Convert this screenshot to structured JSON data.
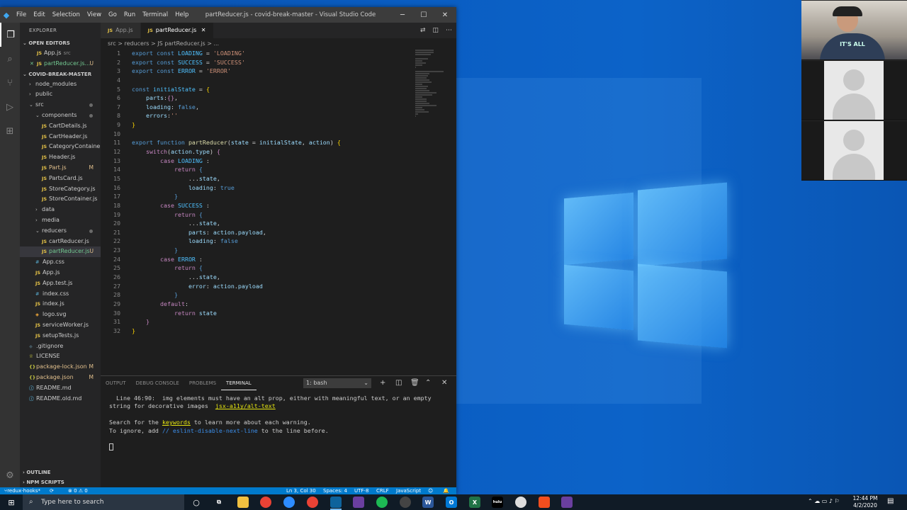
{
  "colors": {
    "accent": "#007acc",
    "desktop": "#0a5dc2",
    "editor_bg": "#1e1e1e"
  },
  "window": {
    "title": "partReducer.js - covid-break-master - Visual Studio Code",
    "menu": [
      "File",
      "Edit",
      "Selection",
      "View",
      "Go",
      "Run",
      "Terminal",
      "Help"
    ]
  },
  "sidebar": {
    "header": "EXPLORER",
    "open_editors_label": "OPEN EDITORS",
    "open_editors": [
      {
        "icon": "JS",
        "name": "App.js",
        "sub": "src"
      },
      {
        "icon": "JS",
        "name": "partReducer.js...",
        "badge": "U"
      }
    ],
    "project_label": "COVID-BREAK-MASTER",
    "tree": [
      {
        "indent": 1,
        "type": "folder",
        "name": "node_modules"
      },
      {
        "indent": 1,
        "type": "folder",
        "name": "public"
      },
      {
        "indent": 1,
        "type": "folder-open",
        "name": "src",
        "dot": true
      },
      {
        "indent": 2,
        "type": "folder-open",
        "name": "components",
        "dot": true
      },
      {
        "indent": 3,
        "icon": "JS",
        "name": "CartDetails.js"
      },
      {
        "indent": 3,
        "icon": "JS",
        "name": "CartHeader.js"
      },
      {
        "indent": 3,
        "icon": "JS",
        "name": "CategoryContainer.js"
      },
      {
        "indent": 3,
        "icon": "JS",
        "name": "Header.js"
      },
      {
        "indent": 3,
        "icon": "JS",
        "name": "Part.js",
        "badge": "M",
        "state": "mod"
      },
      {
        "indent": 3,
        "icon": "JS",
        "name": "PartsCard.js"
      },
      {
        "indent": 3,
        "icon": "JS",
        "name": "StoreCategory.js"
      },
      {
        "indent": 3,
        "icon": "JS",
        "name": "StoreContainer.js"
      },
      {
        "indent": 2,
        "type": "folder",
        "name": "data"
      },
      {
        "indent": 2,
        "type": "folder",
        "name": "media"
      },
      {
        "indent": 2,
        "type": "folder-open",
        "name": "reducers",
        "dot": true
      },
      {
        "indent": 3,
        "icon": "JS",
        "name": "cartReducer.js"
      },
      {
        "indent": 3,
        "icon": "JS",
        "name": "partReducer.js",
        "badge": "U",
        "state": "untr",
        "selected": true
      },
      {
        "indent": 2,
        "icon": "#",
        "name": "App.css"
      },
      {
        "indent": 2,
        "icon": "JS",
        "name": "App.js"
      },
      {
        "indent": 2,
        "icon": "JS",
        "name": "App.test.js"
      },
      {
        "indent": 2,
        "icon": "#",
        "name": "index.css"
      },
      {
        "indent": 2,
        "icon": "JS",
        "name": "index.js"
      },
      {
        "indent": 2,
        "icon": "◈",
        "name": "logo.svg"
      },
      {
        "indent": 2,
        "icon": "JS",
        "name": "serviceWorker.js"
      },
      {
        "indent": 2,
        "icon": "JS",
        "name": "setupTests.js"
      },
      {
        "indent": 1,
        "icon": "◆",
        "name": ".gitignore"
      },
      {
        "indent": 1,
        "icon": "♕",
        "name": "LICENSE"
      },
      {
        "indent": 1,
        "icon": "{}",
        "name": "package-lock.json",
        "badge": "M",
        "state": "mod"
      },
      {
        "indent": 1,
        "icon": "{}",
        "name": "package.json",
        "badge": "M",
        "state": "mod"
      },
      {
        "indent": 1,
        "icon": "ⓘ",
        "name": "README.md"
      },
      {
        "indent": 1,
        "icon": "ⓘ",
        "name": "README.old.md"
      }
    ],
    "outline_label": "OUTLINE",
    "npm_label": "NPM SCRIPTS"
  },
  "tabs": [
    {
      "icon": "JS",
      "label": "App.js",
      "active": false
    },
    {
      "icon": "JS",
      "label": "partReducer.js",
      "active": true
    }
  ],
  "breadcrumb": "src > reducers > JS partReducer.js > ...",
  "code_lines": [
    [
      [
        "k",
        "export "
      ],
      [
        "k",
        "const "
      ],
      [
        "c",
        "LOADING"
      ],
      [
        "p",
        " = "
      ],
      [
        "s",
        "'LOADING'"
      ]
    ],
    [
      [
        "k",
        "export "
      ],
      [
        "k",
        "const "
      ],
      [
        "c",
        "SUCCESS"
      ],
      [
        "p",
        " = "
      ],
      [
        "s",
        "'SUCCESS'"
      ]
    ],
    [
      [
        "k",
        "export "
      ],
      [
        "k",
        "const "
      ],
      [
        "c",
        "ERROR"
      ],
      [
        "p",
        " = "
      ],
      [
        "s",
        "'ERROR'"
      ]
    ],
    [],
    [
      [
        "k",
        "const "
      ],
      [
        "c",
        "initialState"
      ],
      [
        "p",
        " = "
      ],
      [
        "b",
        "{"
      ]
    ],
    [
      [
        "p",
        "    "
      ],
      [
        "v",
        "parts"
      ],
      [
        "p",
        ":"
      ],
      [
        "kc",
        "{}"
      ],
      [
        "p",
        ","
      ]
    ],
    [
      [
        "p",
        "    "
      ],
      [
        "v",
        "loading"
      ],
      [
        "p",
        ": "
      ],
      [
        "k",
        "false"
      ],
      [
        "p",
        ","
      ]
    ],
    [
      [
        "p",
        "    "
      ],
      [
        "v",
        "errors"
      ],
      [
        "p",
        ":"
      ],
      [
        "s",
        "''"
      ]
    ],
    [
      [
        "b",
        "}"
      ]
    ],
    [],
    [
      [
        "k",
        "export "
      ],
      [
        "k",
        "function "
      ],
      [
        "f",
        "partReducer"
      ],
      [
        "p",
        "("
      ],
      [
        "v",
        "state"
      ],
      [
        "p",
        " = "
      ],
      [
        "v",
        "initialState"
      ],
      [
        "p",
        ", "
      ],
      [
        "v",
        "action"
      ],
      [
        "p",
        ") "
      ],
      [
        "b",
        "{"
      ]
    ],
    [
      [
        "p",
        "    "
      ],
      [
        "kc",
        "switch"
      ],
      [
        "p",
        "("
      ],
      [
        "v",
        "action"
      ],
      [
        "p",
        "."
      ],
      [
        "v",
        "type"
      ],
      [
        "p",
        ") "
      ],
      [
        "kc",
        "{"
      ]
    ],
    [
      [
        "p",
        "        "
      ],
      [
        "kc",
        "case "
      ],
      [
        "c",
        "LOADING"
      ],
      [
        "p",
        " :"
      ]
    ],
    [
      [
        "p",
        "            "
      ],
      [
        "kc",
        "return "
      ],
      [
        "k",
        "{"
      ]
    ],
    [
      [
        "p",
        "                ..."
      ],
      [
        "v",
        "state"
      ],
      [
        "p",
        ","
      ]
    ],
    [
      [
        "p",
        "                "
      ],
      [
        "v",
        "loading"
      ],
      [
        "p",
        ": "
      ],
      [
        "k",
        "true"
      ]
    ],
    [
      [
        "p",
        "            "
      ],
      [
        "k",
        "}"
      ]
    ],
    [
      [
        "p",
        "        "
      ],
      [
        "kc",
        "case "
      ],
      [
        "c",
        "SUCCESS"
      ],
      [
        "p",
        " :"
      ]
    ],
    [
      [
        "p",
        "            "
      ],
      [
        "kc",
        "return "
      ],
      [
        "k",
        "{"
      ]
    ],
    [
      [
        "p",
        "                ..."
      ],
      [
        "v",
        "state"
      ],
      [
        "p",
        ","
      ]
    ],
    [
      [
        "p",
        "                "
      ],
      [
        "v",
        "parts"
      ],
      [
        "p",
        ": "
      ],
      [
        "v",
        "action"
      ],
      [
        "p",
        "."
      ],
      [
        "v",
        "payload"
      ],
      [
        "p",
        ","
      ]
    ],
    [
      [
        "p",
        "                "
      ],
      [
        "v",
        "loading"
      ],
      [
        "p",
        ": "
      ],
      [
        "k",
        "false"
      ]
    ],
    [
      [
        "p",
        "            "
      ],
      [
        "k",
        "}"
      ]
    ],
    [
      [
        "p",
        "        "
      ],
      [
        "kc",
        "case "
      ],
      [
        "c",
        "ERROR"
      ],
      [
        "p",
        " :"
      ]
    ],
    [
      [
        "p",
        "            "
      ],
      [
        "kc",
        "return "
      ],
      [
        "k",
        "{"
      ]
    ],
    [
      [
        "p",
        "                ..."
      ],
      [
        "v",
        "state"
      ],
      [
        "p",
        ","
      ]
    ],
    [
      [
        "p",
        "                "
      ],
      [
        "v",
        "error"
      ],
      [
        "p",
        ": "
      ],
      [
        "v",
        "action"
      ],
      [
        "p",
        "."
      ],
      [
        "v",
        "payload"
      ]
    ],
    [
      [
        "p",
        "            "
      ],
      [
        "k",
        "}"
      ]
    ],
    [
      [
        "p",
        "        "
      ],
      [
        "kc",
        "default"
      ],
      [
        "p",
        ":"
      ]
    ],
    [
      [
        "p",
        "            "
      ],
      [
        "kc",
        "return "
      ],
      [
        "v",
        "state"
      ]
    ],
    [
      [
        "p",
        "    "
      ],
      [
        "kc",
        "}"
      ]
    ],
    [
      [
        "b",
        "}"
      ]
    ]
  ],
  "panel": {
    "tabs": [
      "OUTPUT",
      "DEBUG CONSOLE",
      "PROBLEMS",
      "TERMINAL"
    ],
    "active_tab": "TERMINAL",
    "terminal_select": "1: bash",
    "line1_prefix": "  Line 46:90:  img elements must have an alt prop, either with meaningful text, or an empty",
    "line2_prefix": "string for decorative images  ",
    "line2_link": "jsx-a11y/alt-text",
    "line4_prefix": "Search for the ",
    "line4_link": "keywords",
    "line4_suffix": " to learn more about each warning.",
    "line5_prefix": "To ignore, add ",
    "line5_comment": "// eslint-disable-next-line",
    "line5_suffix": " to the line before."
  },
  "statusbar": {
    "branch": "redux-hooks*",
    "problems": "⊗ 0 ⚠ 0",
    "position": "Ln 3, Col 30",
    "spaces": "Spaces: 4",
    "encoding": "UTF-8",
    "eol": "CRLF",
    "language": "JavaScript"
  },
  "taskbar": {
    "search_placeholder": "Type here to search",
    "time": "12:44 PM",
    "date": "4/2/2020"
  },
  "webcam": {
    "shirt_text": "IT'S ALL"
  }
}
